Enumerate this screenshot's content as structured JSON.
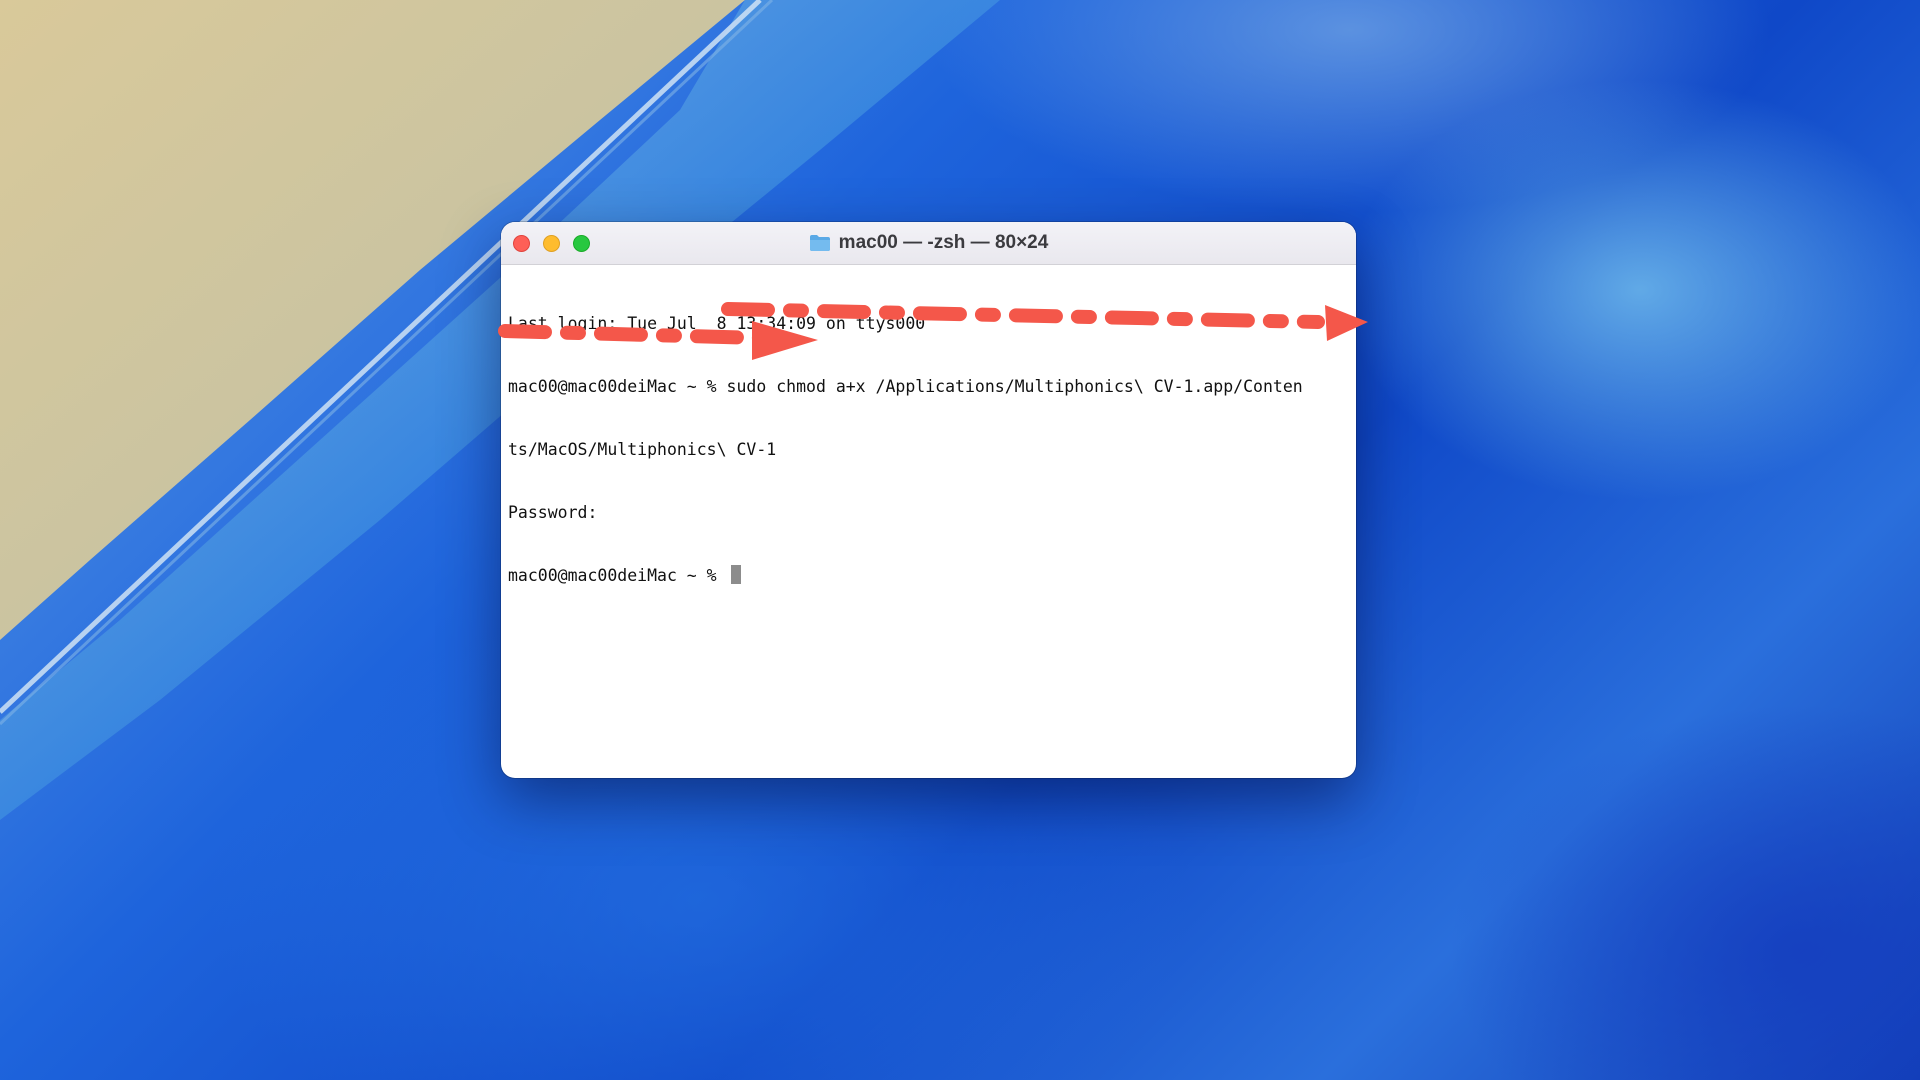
{
  "window": {
    "title": "mac00 — -zsh — 80×24"
  },
  "terminal": {
    "lines": [
      "Last login: Tue Jul  8 13:34:09 on ttys000",
      "mac00@mac00deiMac ~ % sudo chmod a+x /Applications/Multiphonics\\ CV-1.app/Conten",
      "ts/MacOS/Multiphonics\\ CV-1",
      "Password:",
      "mac00@mac00deiMac ~ % "
    ]
  },
  "icons": {
    "close": "close-icon",
    "minimize": "minimize-icon",
    "maximize": "maximize-icon",
    "folder": "folder-icon",
    "cursor": "text-cursor"
  },
  "colors": {
    "annotation_arrow": "#f4574a",
    "close": "#fe5f57",
    "minimize": "#febc2e",
    "maximize": "#28c840",
    "folder": "#5aa9e6"
  }
}
